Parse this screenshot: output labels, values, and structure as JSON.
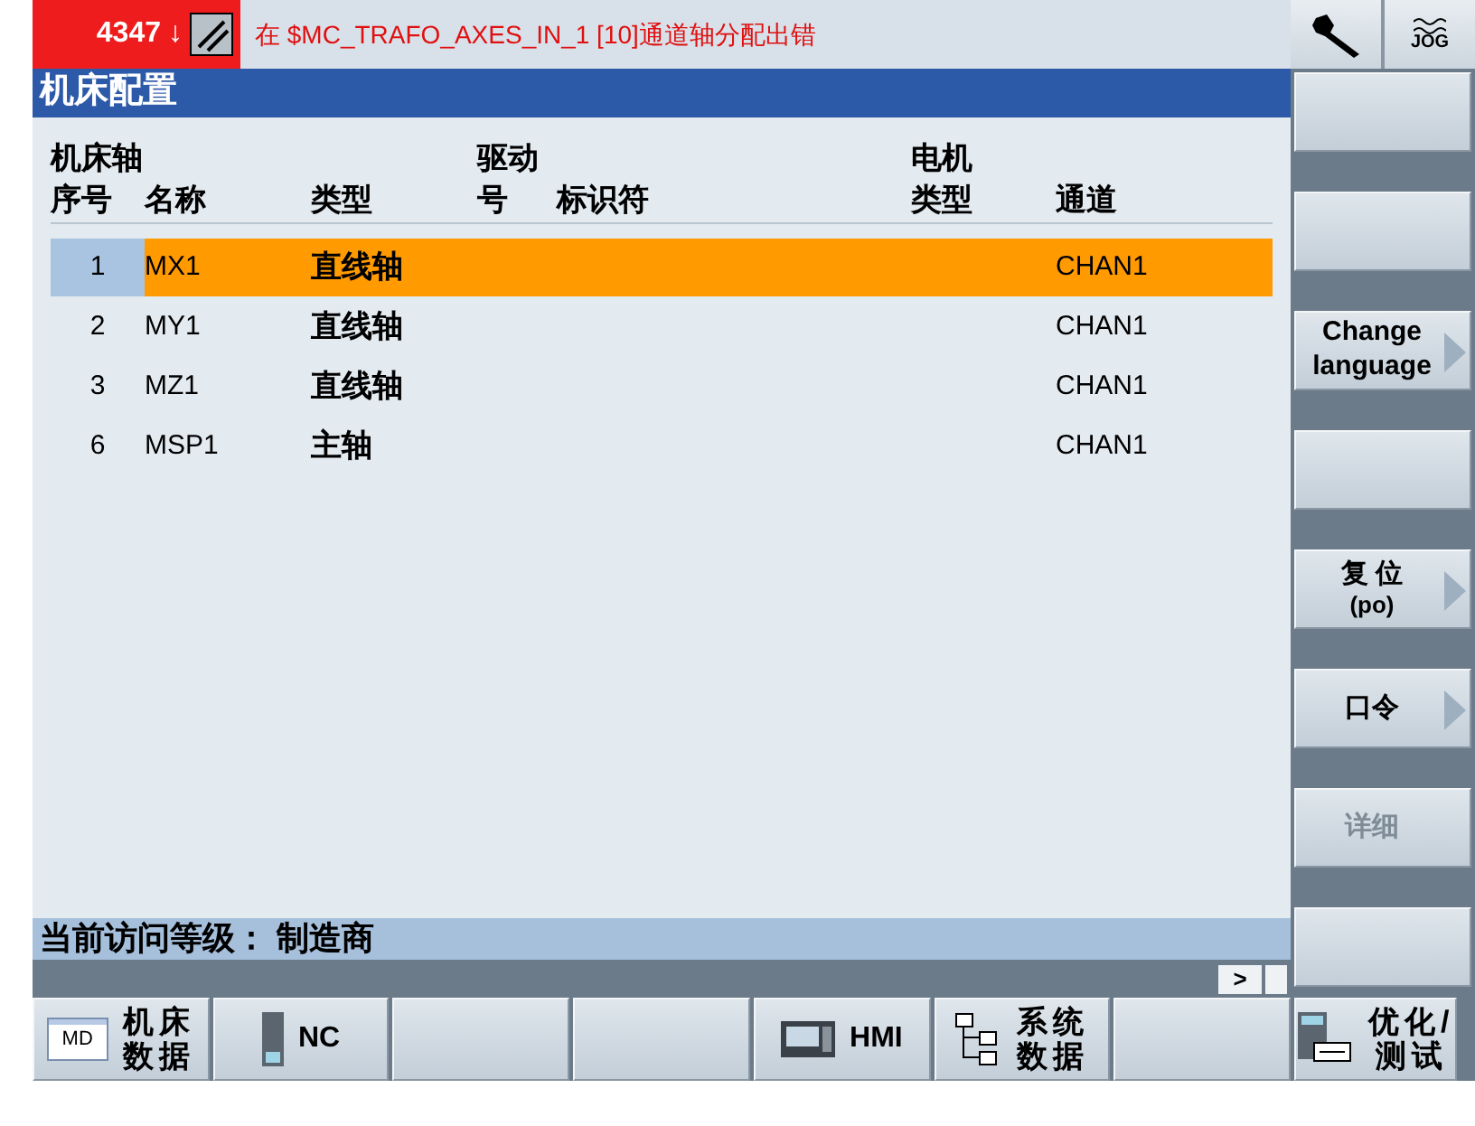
{
  "alarm": {
    "number": "4347",
    "arrow": "↓",
    "message": "在 $MC_TRAFO_AXES_IN_1 [10]通道轴分配出错"
  },
  "top_icons": [
    {
      "kind": "wrench"
    },
    {
      "kind": "jog",
      "label": "JOG"
    }
  ],
  "title": "机床配置",
  "table": {
    "group_headers": [
      "机床轴",
      "驱动",
      "电机"
    ],
    "columns": [
      "序号",
      "名称",
      "类型",
      "号",
      "标识符",
      "类型",
      "通道"
    ],
    "rows": [
      {
        "index": "1",
        "name": "MX1",
        "type": "直线轴",
        "channel": "CHAN1",
        "selected": true
      },
      {
        "index": "2",
        "name": "MY1",
        "type": "直线轴",
        "channel": "CHAN1",
        "selected": false
      },
      {
        "index": "3",
        "name": "MZ1",
        "type": "直线轴",
        "channel": "CHAN1",
        "selected": false
      },
      {
        "index": "6",
        "name": "MSP1",
        "type": "主轴",
        "channel": "CHAN1",
        "selected": false
      }
    ]
  },
  "status_line": "当前访问等级： 制造商",
  "scroll_button": ">",
  "vertical_softkeys": [
    {
      "arrow": false
    },
    {
      "arrow": false
    },
    {
      "label": "Change language",
      "arrow": true,
      "disabled": false
    },
    {
      "arrow": false
    },
    {
      "label": "复 位",
      "sublabel": "(po)",
      "arrow": true,
      "disabled": false
    },
    {
      "label": "口令",
      "arrow": true,
      "disabled": false
    },
    {
      "label": "详细",
      "arrow": false,
      "disabled": true
    },
    {
      "arrow": false
    }
  ],
  "horizontal_softkeys": [
    {
      "kind": "md",
      "icon_text": "MD",
      "label_lines": [
        "机床",
        "数据"
      ]
    },
    {
      "kind": "nc",
      "label": "NC"
    },
    {
      "kind": "empty"
    },
    {
      "kind": "empty"
    },
    {
      "kind": "hmi",
      "label": "HMI"
    },
    {
      "kind": "tree",
      "label_lines": [
        "系统",
        "数据"
      ]
    },
    {
      "kind": "empty"
    },
    {
      "kind": "drive",
      "label_lines": [
        "优化/",
        "测试"
      ]
    }
  ]
}
